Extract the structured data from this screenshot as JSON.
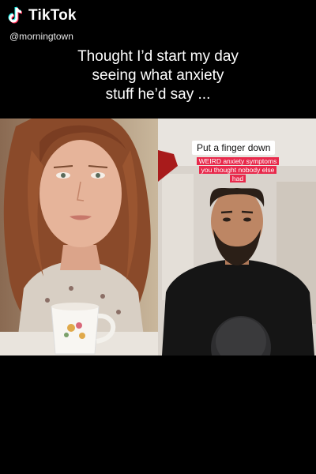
{
  "header": {
    "brand": "TikTok",
    "handle": "@morningtown"
  },
  "caption": {
    "lines": [
      "Thought I’d start my day",
      "seeing what anxiety",
      "stuff he’d say ..."
    ]
  },
  "overlay": {
    "title": "Put a finger down",
    "subtitle_lines": [
      "WEIRD anxiety symptoms",
      "you thought nobody else",
      "had"
    ]
  },
  "icons": {
    "brand_logo": "tiktok-note-icon",
    "microphone": "microphone-icon"
  },
  "colors": {
    "background": "#000000",
    "overlay_subtitle_bg": "#e8294b",
    "logo_cyan": "#25f4ee",
    "logo_pink": "#fe2c55"
  }
}
